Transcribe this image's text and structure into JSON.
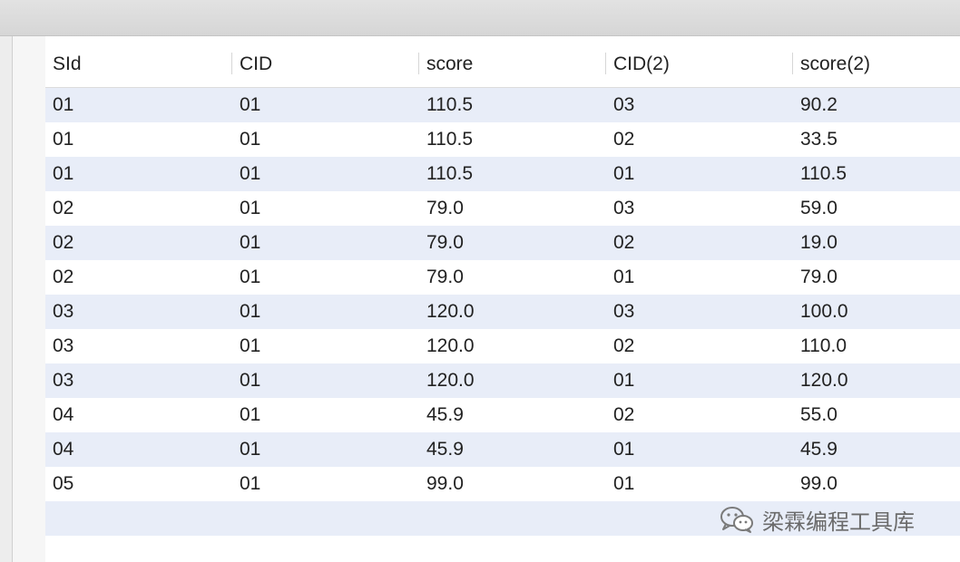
{
  "table": {
    "columns": [
      "SId",
      "CID",
      "score",
      "CID(2)",
      "score(2)"
    ],
    "rows": [
      [
        "01",
        "01",
        "110.5",
        "03",
        "90.2"
      ],
      [
        "01",
        "01",
        "110.5",
        "02",
        "33.5"
      ],
      [
        "01",
        "01",
        "110.5",
        "01",
        "110.5"
      ],
      [
        "02",
        "01",
        "79.0",
        "03",
        "59.0"
      ],
      [
        "02",
        "01",
        "79.0",
        "02",
        "19.0"
      ],
      [
        "02",
        "01",
        "79.0",
        "01",
        "79.0"
      ],
      [
        "03",
        "01",
        "120.0",
        "03",
        "100.0"
      ],
      [
        "03",
        "01",
        "120.0",
        "02",
        "110.0"
      ],
      [
        "03",
        "01",
        "120.0",
        "01",
        "120.0"
      ],
      [
        "04",
        "01",
        "45.9",
        "02",
        "55.0"
      ],
      [
        "04",
        "01",
        "45.9",
        "01",
        "45.9"
      ],
      [
        "05",
        "01",
        "99.0",
        "01",
        "99.0"
      ]
    ]
  },
  "watermark": {
    "text": "梁霖编程工具库",
    "icon": "wechat-icon"
  },
  "colors": {
    "row_alt": "#e8edf8",
    "toolbar": "#dcdcdc",
    "text": "#222222"
  }
}
